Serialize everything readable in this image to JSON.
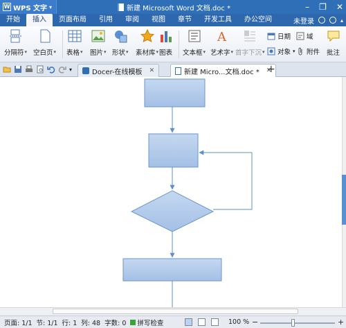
{
  "titlebar": {
    "app_name": "WPS 文字",
    "doc_title": "新建 Microsoft Word 文档.doc *"
  },
  "menu": {
    "tabs": [
      "开始",
      "插入",
      "页面布局",
      "引用",
      "审阅",
      "视图",
      "章节",
      "开发工具",
      "办公空间"
    ],
    "active_tab": "插入",
    "login": "未登录"
  },
  "ribbon": {
    "page_break": "分隔符",
    "blank_page": "空白页",
    "table": "表格",
    "picture": "图片",
    "shape": "形状",
    "material": "素材库",
    "chart": "图表",
    "textbox": "文本框",
    "wordart": "艺术字",
    "drop_cap": "首字下沉",
    "date": "日期",
    "field": "域",
    "object": "对象",
    "attachment": "附件",
    "comment": "批注"
  },
  "tabs": {
    "docer": "Docer-在线模板",
    "document": "新建 Micro...文档.doc *"
  },
  "status": {
    "page": "页面: 1/1",
    "section": "节: 1/1",
    "line": "行: 1",
    "column": "列: 48",
    "word_count": "字数: 0",
    "spell": "拼写检查",
    "zoom": "100 %",
    "zoom_level": 1.0
  }
}
